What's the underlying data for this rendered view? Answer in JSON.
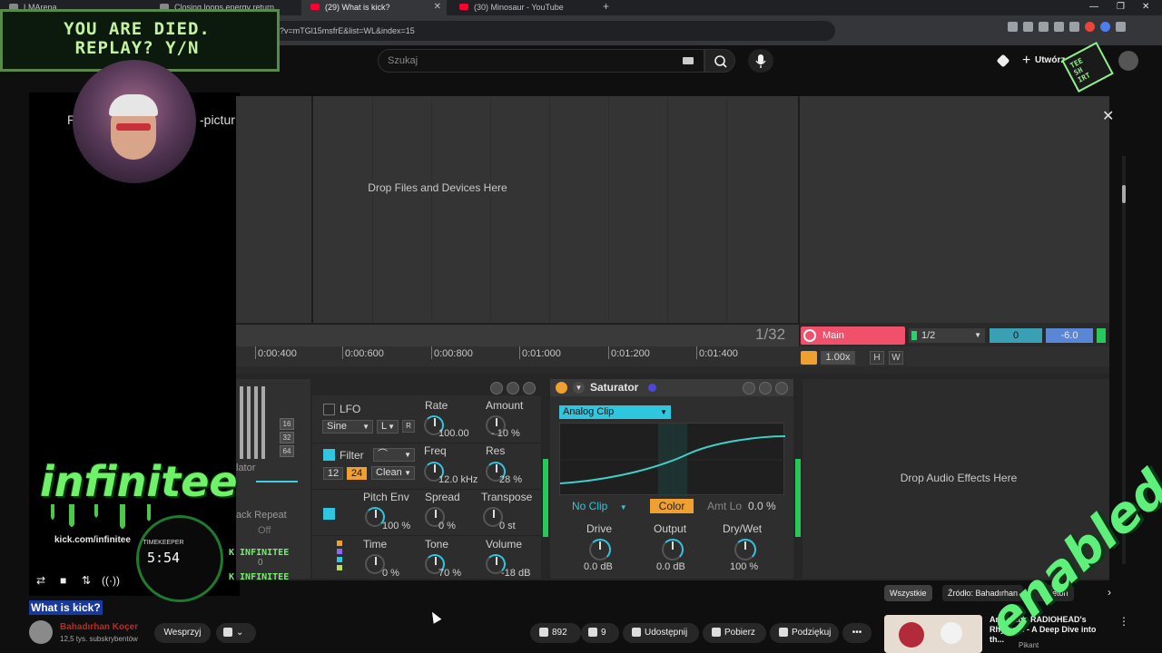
{
  "browser": {
    "tabs": [
      {
        "label": "LMArena",
        "active": false
      },
      {
        "label": "Closing loops energy return",
        "active": false
      },
      {
        "label": "(29) What is kick?",
        "active": true
      },
      {
        "label": "(30) Minosaur - YouTube",
        "active": false
      }
    ],
    "new_tab": "+",
    "url": "?v=mTGl15msfrE&list=WL&index=15",
    "window_controls": [
      "—",
      "❐",
      "✕"
    ]
  },
  "youtube": {
    "search_placeholder": "Szukaj",
    "create_label": "Utwórz",
    "video_title": "What is kick?",
    "channel_name": "Bahadırhan Koçer",
    "channel_subs": "12,5 tys. subskrybentów",
    "buttons": {
      "support": "Wesprzyj",
      "likes": "892",
      "dislikes": "9",
      "share": "Udostępnij",
      "download": "Pobierz",
      "thanks": "Podziękuj",
      "more": "•••"
    },
    "chips": [
      "Wszystkie",
      "Źródło: Bahadırhan",
      "Ableton"
    ],
    "side_video": {
      "title": "Analyzing RADIOHEAD's Rhythms - A Deep Dive into th...",
      "channel": "Pikant"
    },
    "player_text_left": "P",
    "player_text_right": "-pictur"
  },
  "overlay": {
    "died_line1": "YOU ARE DIED.",
    "died_line2": "REPLAY? Y/N",
    "logo": "infinitee",
    "kick_url": "kick.com/infinitee",
    "timekeeper_label": "TIMEKEEPER",
    "timekeeper_value": "5:54",
    "badge": "K INFINITEE",
    "stamp": "enabled",
    "sticker": "TEE\nSH\nIRT"
  },
  "ableton": {
    "drop_files": "Drop Files and Devices Here",
    "ruler": [
      "0:00:400",
      "0:00:600",
      "0:00:800",
      "0:01:000",
      "0:01:200",
      "0:01:400"
    ],
    "quantize": "1/32",
    "main_track": "Main",
    "clip_quant": "1/2",
    "send_value": "0",
    "volume_value": "-6.0",
    "speed": "1.00x",
    "h_btn": "H",
    "w_btn": "W",
    "synth": {
      "octaves": [
        "16",
        "32",
        "64"
      ],
      "ator_label": "lator",
      "back_repeat": "ack Repeat",
      "off": "Off",
      "small": "0",
      "lfo": {
        "label": "LFO",
        "wave": "Sine",
        "mode": "L",
        "retrig": "R"
      },
      "rate": {
        "label": "Rate",
        "value": "100.00"
      },
      "amount": {
        "label": "Amount",
        "value": "- 10 %"
      },
      "filter": {
        "label": "Filter",
        "slope_a": "12",
        "slope_b": "24",
        "type": "Clean"
      },
      "freq": {
        "label": "Freq",
        "value": "12.0 kHz"
      },
      "res": {
        "label": "Res",
        "value": "28 %"
      },
      "pitch_env": {
        "label": "Pitch Env",
        "value": "100 %"
      },
      "spread": {
        "label": "Spread",
        "value": "0 %"
      },
      "transpose": {
        "label": "Transpose",
        "value": "0 st"
      },
      "time": {
        "label": "Time",
        "value": "0 %"
      },
      "tone": {
        "label": "Tone",
        "value": "70 %"
      },
      "volume": {
        "label": "Volume",
        "value": "-18 dB"
      }
    },
    "saturator": {
      "title": "Saturator",
      "mode": "Analog Clip",
      "clip": "No Clip",
      "color": "Color",
      "amt_lo_label": "Amt Lo",
      "amt_lo_value": "0.0 %",
      "drive": {
        "label": "Drive",
        "value": "0.0 dB"
      },
      "output": {
        "label": "Output",
        "value": "0.0 dB"
      },
      "drywet": {
        "label": "Dry/Wet",
        "value": "100 %"
      }
    },
    "drop_audio": "Drop Audio Effects Here",
    "close": "✕"
  },
  "colors": {
    "accent_cyan": "#2fc7e0",
    "accent_orange": "#f0a030",
    "main_red": "#f0506a",
    "overlay_green": "#6ff26a"
  }
}
